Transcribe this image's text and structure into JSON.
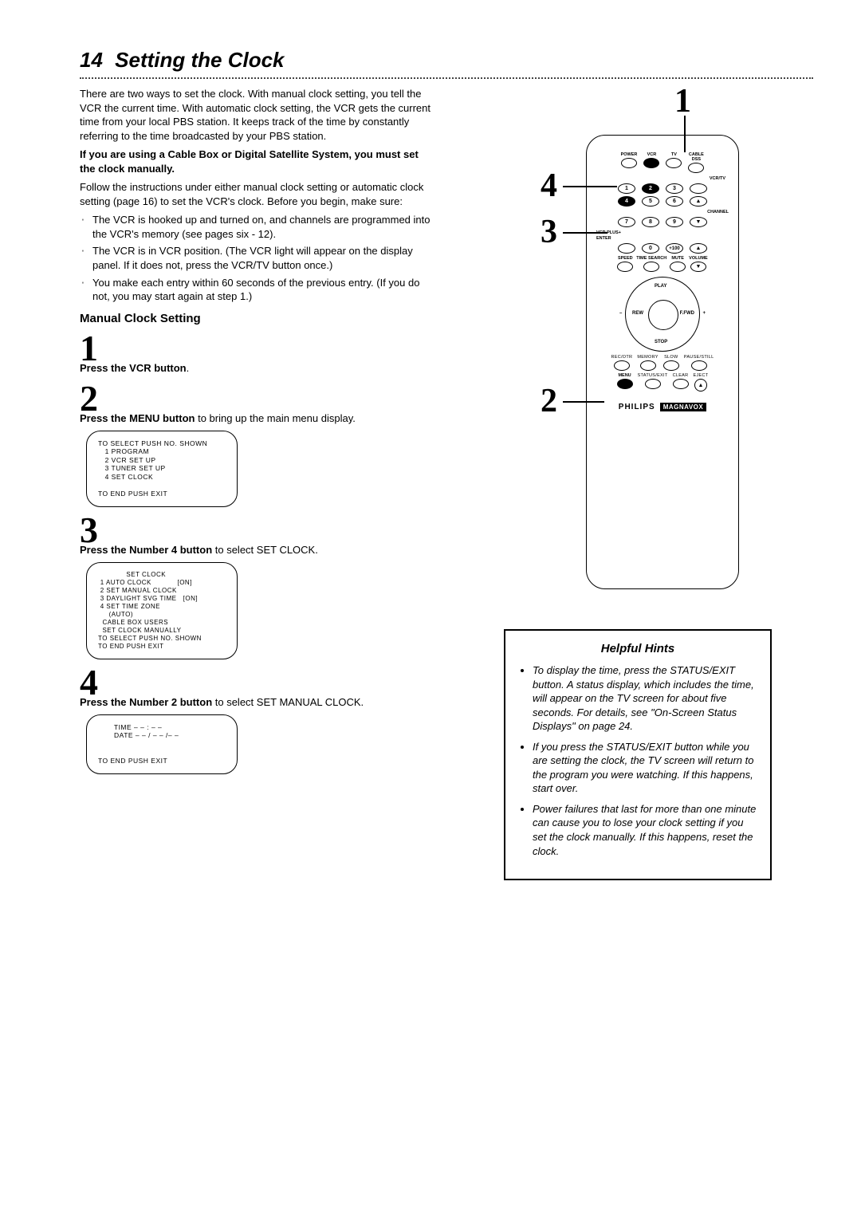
{
  "page": {
    "num": "14",
    "title": "Setting the Clock"
  },
  "intro": "There are two ways to set the clock. With manual clock setting, you tell the VCR the current time. With automatic clock setting, the VCR gets the current time from your local PBS station. It keeps track of the time by constantly referring to the time broadcasted by your PBS station.",
  "warn": "If you are using a Cable Box or Digital Satellite System, you must set the clock manually.",
  "follow": "Follow the instructions under either manual clock setting or automatic clock setting (page 16) to set the VCR's clock. Before you begin, make sure:",
  "bullets": [
    "The VCR is hooked up and turned on, and channels are programmed into the VCR's memory (see pages six - 12).",
    "The VCR is in VCR position. (The VCR light will appear on the display panel. If it does not, press the VCR/TV button once.)",
    "You make each entry within 60 seconds of the previous entry. (If you do not, you may start again at step 1.)"
  ],
  "section_heading": "Manual Clock Setting",
  "steps": {
    "s1": {
      "num": "1",
      "bold": "Press the VCR button",
      "rest": "."
    },
    "s2": {
      "num": "2",
      "bold": "Press the MENU button",
      "rest": " to bring up the main menu display."
    },
    "s3": {
      "num": "3",
      "bold": "Press the Number 4 button",
      "rest": " to select SET CLOCK."
    },
    "s4": {
      "num": "4",
      "bold": "Press the Number 2 button",
      "rest": " to select SET MANUAL CLOCK."
    }
  },
  "screen1": "TO SELECT PUSH NO. SHOWN\n   1 PROGRAM\n   2 VCR SET UP\n   3 TUNER SET UP\n   4 SET CLOCK\n\nTO END PUSH EXIT",
  "screen2": "             SET CLOCK\n 1 AUTO CLOCK            [ON]\n 2 SET MANUAL CLOCK\n 3 DAYLIGHT SVG TIME   [ON]\n 4 SET TIME ZONE\n     (AUTO)\n  CABLE BOX USERS\n  SET CLOCK MANUALLY\nTO SELECT PUSH NO. SHOWN\nTO END PUSH EXIT",
  "screen3": "       TIME – – : – –\n       DATE – – / – – /– –\n\n\nTO END PUSH EXIT",
  "remote": {
    "row1": [
      "POWER",
      "VCR",
      "TV",
      "CABLE\nDSS"
    ],
    "vcrtv": "VCR/TV",
    "numpad": [
      "1",
      "2",
      "3",
      "4",
      "5",
      "6",
      "7",
      "8",
      "9",
      "0",
      "+100"
    ],
    "channel": "CHANNEL",
    "vcrplus": "VCR PLUS+\nENTER",
    "row_bot": [
      "SPEED",
      "TIME SEARCH",
      "MUTE",
      "VOLUME"
    ],
    "nav": {
      "play": "PLAY",
      "stop": "STOP",
      "rew": "REW",
      "ff": "F.FWD",
      "minus": "–",
      "plus": "+"
    },
    "row_a": [
      "REC/OTR",
      "MEMORY",
      "SLOW",
      "PAUSE/STILL"
    ],
    "row_b": [
      "MENU",
      "STATUS/EXIT",
      "CLEAR",
      "EJECT"
    ],
    "brand1": "PHILIPS",
    "brand2": "MAGNAVOX"
  },
  "callouts": {
    "c1": "1",
    "c2": "2",
    "c3": "3",
    "c4": "4"
  },
  "hints": {
    "title": "Helpful Hints",
    "items": [
      "To display the time, press the STATUS/EXIT button. A status display, which includes the time, will appear on the TV screen for about five seconds. For details, see \"On-Screen Status Displays\" on page 24.",
      "If you press the STATUS/EXIT button while you are setting the clock, the TV screen will return to the program you were watching. If this happens, start over.",
      "Power failures that last for more than one minute can cause you to lose your clock setting if you set the clock manually. If this happens, reset the clock."
    ]
  }
}
